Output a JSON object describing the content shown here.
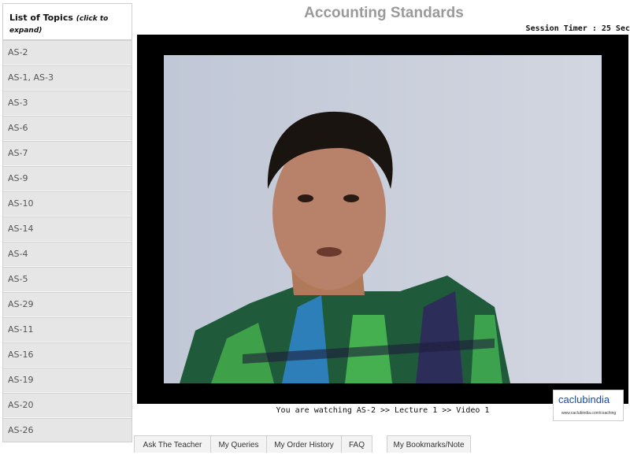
{
  "sidebar": {
    "header_main": "List of Topics",
    "header_note": "(click to expand)",
    "items": [
      "AS-2",
      "AS-1, AS-3",
      "AS-3",
      "AS-6",
      "AS-7",
      "AS-9",
      "AS-10",
      "AS-14",
      "AS-4",
      "AS-5",
      "AS-29",
      "AS-11",
      "AS-16",
      "AS-19",
      "AS-20",
      "AS-26"
    ]
  },
  "main": {
    "title": "Accounting Standards",
    "session_timer": "Session Timer : 25 Sec",
    "watching": "You are watching AS-2 >> Lecture 1 >> Video 1",
    "logo_text": "caclubindia",
    "logo_sub": "www.caclubindia.com/coaching"
  },
  "tabs": [
    {
      "label": "Ask The Teacher"
    },
    {
      "label": "My Queries"
    },
    {
      "label": "My Order History"
    },
    {
      "label": "FAQ"
    },
    {
      "label": "My Bookmarks/Note"
    }
  ]
}
